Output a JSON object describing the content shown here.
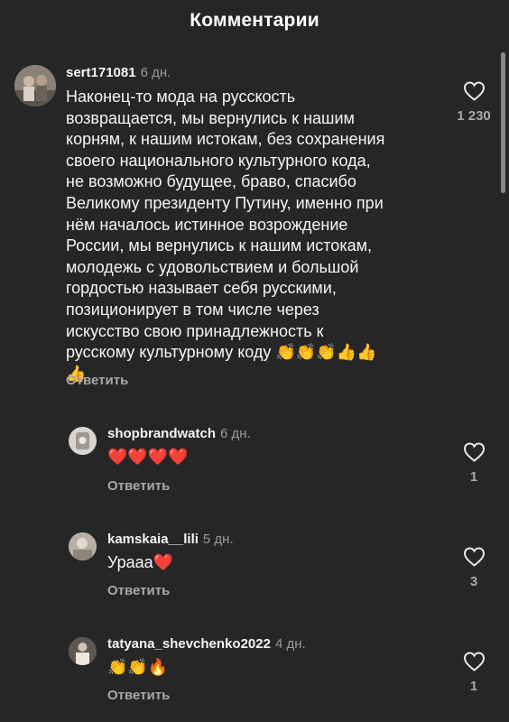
{
  "header": {
    "title": "Комментарии"
  },
  "icons": {
    "heart": "heart-outline-icon",
    "red_heart": "❤",
    "clap": "👏",
    "thumb": "👍",
    "fire": "🔥"
  },
  "colors": {
    "background": "#262626",
    "text": "#f5f5f5",
    "muted": "#a8a8a8",
    "heart_red": "#f0303b"
  },
  "comments": [
    {
      "username": "sert171081",
      "time": "6 дн.",
      "text": "Наконец-то мода на русскость\nвозвращается, мы вернулись к нашим\nкорням, к нашим истокам, без сохранения\nсвоего национального культурного кода,\nне возможно будущее, браво, спасибо\nВеликому президенту Путину, именно при\nнём началось истинное возрождение\nРоссии, мы вернулись к нашим истокам,\nмолодежь с удовольствием и большой\nгордостью называет себя русскими,\nпозиционирует в том числе через\nискусство свою принадлежность к\nрусскому культурному коду",
      "reply_label": "Ответить",
      "likes": "1 230"
    },
    {
      "username": "shopbrandwatch",
      "time": "6 дн.",
      "text": "",
      "reply_label": "Ответить",
      "likes": "1"
    },
    {
      "username": "kamskaia__lili",
      "time": "5 дн.",
      "text": "Урааа",
      "reply_label": "Ответить",
      "likes": "3"
    },
    {
      "username": "tatyana_shevchenko2022",
      "time": "4 дн.",
      "text": "",
      "reply_label": "Ответить",
      "likes": "1"
    }
  ]
}
